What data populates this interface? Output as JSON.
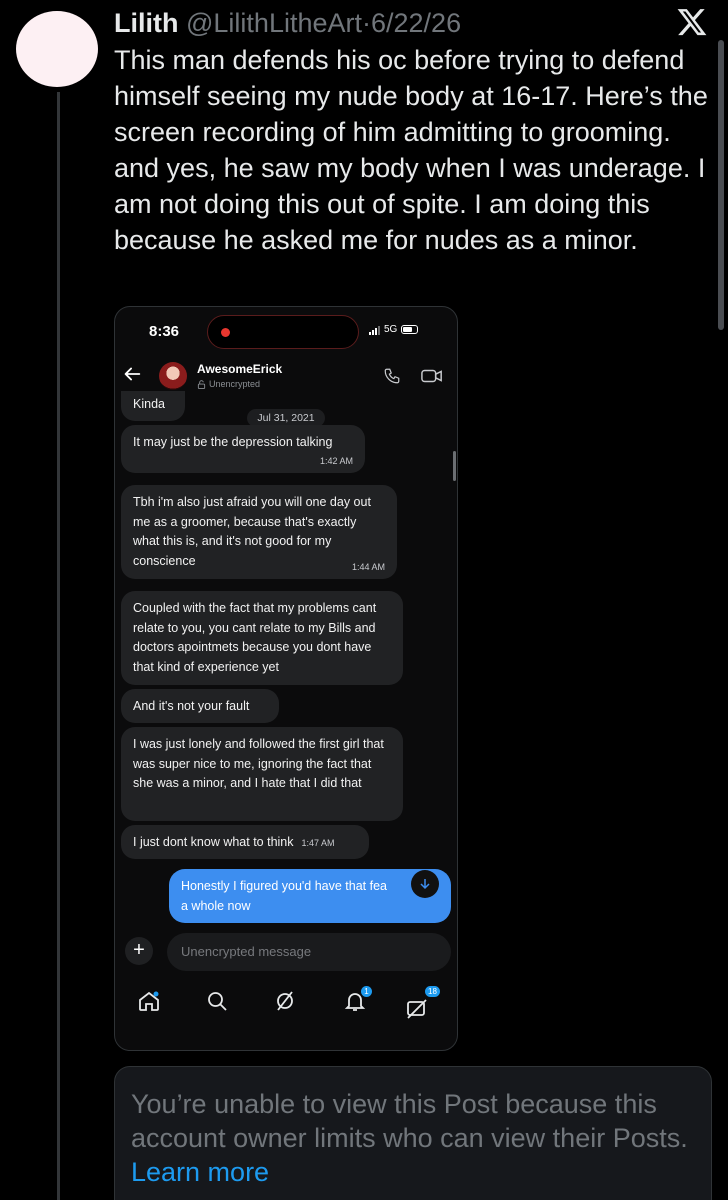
{
  "post": {
    "display_name": "Lilith",
    "handle": "@LilithLitheArt",
    "separator": "·",
    "date": "6/22/26",
    "text": "This man defends his oc before trying to defend himself seeing my nude body at 16-17. Here’s the screen recording of him admitting to grooming. and yes, he saw my body when I was underage. I am not doing this out of spite. I am doing this because he asked me for nudes as a minor."
  },
  "embedded_screenshot": {
    "status_time": "8:36",
    "network": "5G",
    "contact_name": "AwesomeErick",
    "contact_status": "Unencrypted",
    "date_pill": "Jul 31, 2021",
    "messages": [
      {
        "text": "Kinda",
        "time": ""
      },
      {
        "text": "It may just be the depression talking",
        "time": "1:42 AM"
      },
      {
        "text": "Tbh i'm also just afraid you will one day out me as a groomer, because that's exactly what this is, and it's not good for my conscience",
        "time": "1:44 AM"
      },
      {
        "text": "Coupled with the fact that my problems cant relate to you, you cant relate to my Bills and doctors apointmets because you dont have that kind of experience yet",
        "time": ""
      },
      {
        "text": "And it's not your fault",
        "time": ""
      },
      {
        "text": "I was just lonely and followed the first girl that was super nice to me, ignoring the fact that she was a minor, and I hate that I did that",
        "time": ""
      },
      {
        "text": "I just dont know what to think",
        "time": "1:47 AM"
      }
    ],
    "sent_message": "Honestly I figured you'd have that fea... a whole now",
    "sent_line1": "Honestly I figured you'd have that fea",
    "sent_line2": "a whole now",
    "composer_placeholder": "Unencrypted message",
    "notifications_badge": "1",
    "messages_badge": "18"
  },
  "unavailable_card": {
    "text": "You’re unable to view this Post because this account owner limits who can view their Posts.",
    "link_text": "Learn more"
  },
  "colors": {
    "background": "#000000",
    "link": "#1d9bf0",
    "sent_bubble": "#3d8ef0",
    "received_bubble": "#212224"
  }
}
